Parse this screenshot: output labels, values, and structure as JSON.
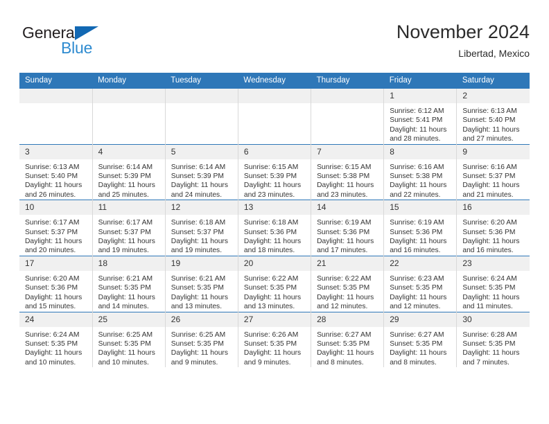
{
  "logo": {
    "word_one": "General",
    "word_two": "Blue",
    "triangle_icon": "triangle-icon",
    "accent_dark": "#231f20",
    "accent_blue": "#2e8bd0"
  },
  "header": {
    "month_title": "November 2024",
    "location": "Libertad, Mexico"
  },
  "theme": {
    "header_blue": "#2e77b8",
    "daynum_band": "#f0f0f0",
    "grid_line": "#d8d8d8"
  },
  "calendar": {
    "weekday_headers": [
      "Sunday",
      "Monday",
      "Tuesday",
      "Wednesday",
      "Thursday",
      "Friday",
      "Saturday"
    ],
    "weeks": [
      [
        {
          "day": "",
          "empty": true
        },
        {
          "day": "",
          "empty": true
        },
        {
          "day": "",
          "empty": true
        },
        {
          "day": "",
          "empty": true
        },
        {
          "day": "",
          "empty": true
        },
        {
          "day": "1",
          "sunrise": "Sunrise: 6:12 AM",
          "sunset": "Sunset: 5:41 PM",
          "daylight": "Daylight: 11 hours and 28 minutes."
        },
        {
          "day": "2",
          "sunrise": "Sunrise: 6:13 AM",
          "sunset": "Sunset: 5:40 PM",
          "daylight": "Daylight: 11 hours and 27 minutes."
        }
      ],
      [
        {
          "day": "3",
          "sunrise": "Sunrise: 6:13 AM",
          "sunset": "Sunset: 5:40 PM",
          "daylight": "Daylight: 11 hours and 26 minutes."
        },
        {
          "day": "4",
          "sunrise": "Sunrise: 6:14 AM",
          "sunset": "Sunset: 5:39 PM",
          "daylight": "Daylight: 11 hours and 25 minutes."
        },
        {
          "day": "5",
          "sunrise": "Sunrise: 6:14 AM",
          "sunset": "Sunset: 5:39 PM",
          "daylight": "Daylight: 11 hours and 24 minutes."
        },
        {
          "day": "6",
          "sunrise": "Sunrise: 6:15 AM",
          "sunset": "Sunset: 5:39 PM",
          "daylight": "Daylight: 11 hours and 23 minutes."
        },
        {
          "day": "7",
          "sunrise": "Sunrise: 6:15 AM",
          "sunset": "Sunset: 5:38 PM",
          "daylight": "Daylight: 11 hours and 23 minutes."
        },
        {
          "day": "8",
          "sunrise": "Sunrise: 6:16 AM",
          "sunset": "Sunset: 5:38 PM",
          "daylight": "Daylight: 11 hours and 22 minutes."
        },
        {
          "day": "9",
          "sunrise": "Sunrise: 6:16 AM",
          "sunset": "Sunset: 5:37 PM",
          "daylight": "Daylight: 11 hours and 21 minutes."
        }
      ],
      [
        {
          "day": "10",
          "sunrise": "Sunrise: 6:17 AM",
          "sunset": "Sunset: 5:37 PM",
          "daylight": "Daylight: 11 hours and 20 minutes."
        },
        {
          "day": "11",
          "sunrise": "Sunrise: 6:17 AM",
          "sunset": "Sunset: 5:37 PM",
          "daylight": "Daylight: 11 hours and 19 minutes."
        },
        {
          "day": "12",
          "sunrise": "Sunrise: 6:18 AM",
          "sunset": "Sunset: 5:37 PM",
          "daylight": "Daylight: 11 hours and 19 minutes."
        },
        {
          "day": "13",
          "sunrise": "Sunrise: 6:18 AM",
          "sunset": "Sunset: 5:36 PM",
          "daylight": "Daylight: 11 hours and 18 minutes."
        },
        {
          "day": "14",
          "sunrise": "Sunrise: 6:19 AM",
          "sunset": "Sunset: 5:36 PM",
          "daylight": "Daylight: 11 hours and 17 minutes."
        },
        {
          "day": "15",
          "sunrise": "Sunrise: 6:19 AM",
          "sunset": "Sunset: 5:36 PM",
          "daylight": "Daylight: 11 hours and 16 minutes."
        },
        {
          "day": "16",
          "sunrise": "Sunrise: 6:20 AM",
          "sunset": "Sunset: 5:36 PM",
          "daylight": "Daylight: 11 hours and 16 minutes."
        }
      ],
      [
        {
          "day": "17",
          "sunrise": "Sunrise: 6:20 AM",
          "sunset": "Sunset: 5:36 PM",
          "daylight": "Daylight: 11 hours and 15 minutes."
        },
        {
          "day": "18",
          "sunrise": "Sunrise: 6:21 AM",
          "sunset": "Sunset: 5:35 PM",
          "daylight": "Daylight: 11 hours and 14 minutes."
        },
        {
          "day": "19",
          "sunrise": "Sunrise: 6:21 AM",
          "sunset": "Sunset: 5:35 PM",
          "daylight": "Daylight: 11 hours and 13 minutes."
        },
        {
          "day": "20",
          "sunrise": "Sunrise: 6:22 AM",
          "sunset": "Sunset: 5:35 PM",
          "daylight": "Daylight: 11 hours and 13 minutes."
        },
        {
          "day": "21",
          "sunrise": "Sunrise: 6:22 AM",
          "sunset": "Sunset: 5:35 PM",
          "daylight": "Daylight: 11 hours and 12 minutes."
        },
        {
          "day": "22",
          "sunrise": "Sunrise: 6:23 AM",
          "sunset": "Sunset: 5:35 PM",
          "daylight": "Daylight: 11 hours and 12 minutes."
        },
        {
          "day": "23",
          "sunrise": "Sunrise: 6:24 AM",
          "sunset": "Sunset: 5:35 PM",
          "daylight": "Daylight: 11 hours and 11 minutes."
        }
      ],
      [
        {
          "day": "24",
          "sunrise": "Sunrise: 6:24 AM",
          "sunset": "Sunset: 5:35 PM",
          "daylight": "Daylight: 11 hours and 10 minutes."
        },
        {
          "day": "25",
          "sunrise": "Sunrise: 6:25 AM",
          "sunset": "Sunset: 5:35 PM",
          "daylight": "Daylight: 11 hours and 10 minutes."
        },
        {
          "day": "26",
          "sunrise": "Sunrise: 6:25 AM",
          "sunset": "Sunset: 5:35 PM",
          "daylight": "Daylight: 11 hours and 9 minutes."
        },
        {
          "day": "27",
          "sunrise": "Sunrise: 6:26 AM",
          "sunset": "Sunset: 5:35 PM",
          "daylight": "Daylight: 11 hours and 9 minutes."
        },
        {
          "day": "28",
          "sunrise": "Sunrise: 6:27 AM",
          "sunset": "Sunset: 5:35 PM",
          "daylight": "Daylight: 11 hours and 8 minutes."
        },
        {
          "day": "29",
          "sunrise": "Sunrise: 6:27 AM",
          "sunset": "Sunset: 5:35 PM",
          "daylight": "Daylight: 11 hours and 8 minutes."
        },
        {
          "day": "30",
          "sunrise": "Sunrise: 6:28 AM",
          "sunset": "Sunset: 5:35 PM",
          "daylight": "Daylight: 11 hours and 7 minutes."
        }
      ]
    ]
  }
}
